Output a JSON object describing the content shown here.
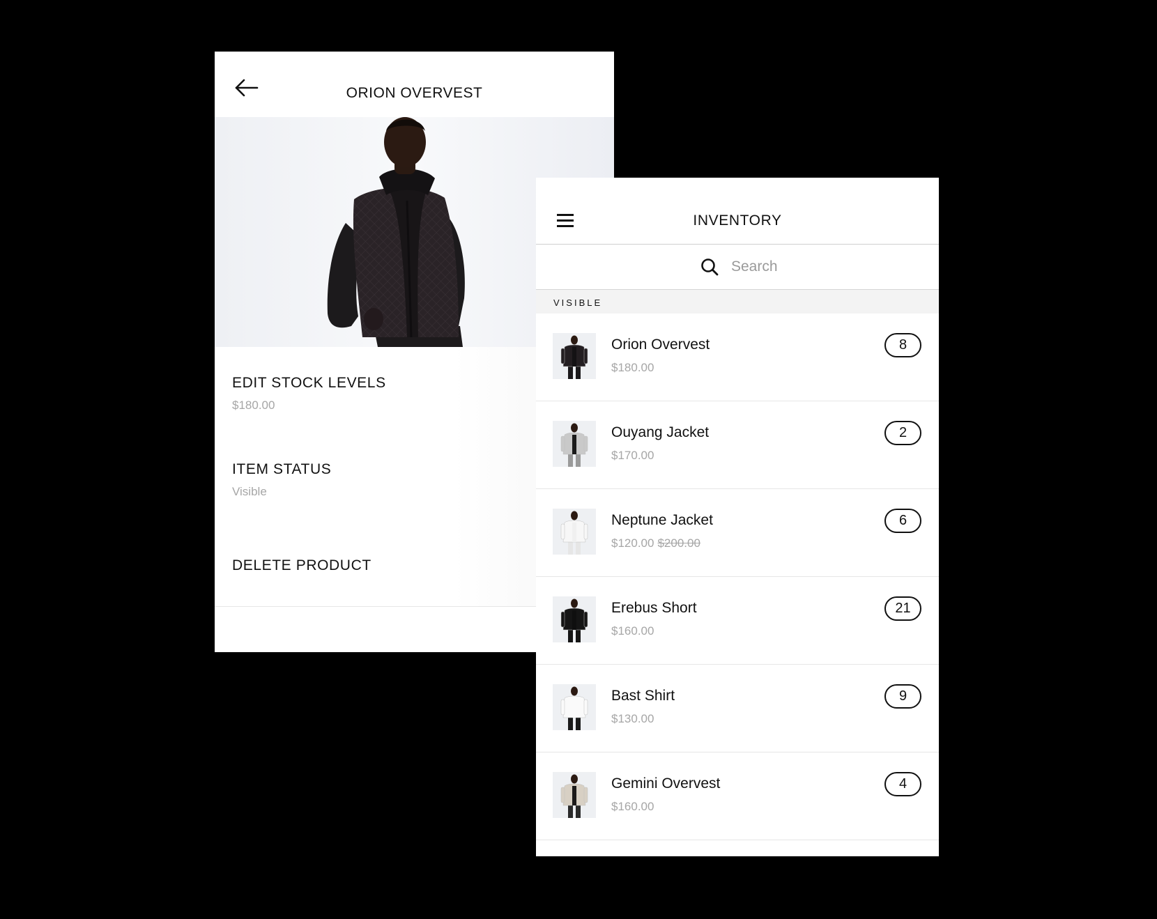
{
  "detail": {
    "title": "ORION OVERVEST",
    "sections": {
      "edit_stock": {
        "label": "EDIT STOCK LEVELS",
        "sub": "$180.00"
      },
      "item_status": {
        "label": "ITEM STATUS",
        "sub": "Visible"
      },
      "delete": {
        "label": "DELETE PRODUCT"
      }
    }
  },
  "inventory": {
    "title": "INVENTORY",
    "search": {
      "placeholder": "Search"
    },
    "section_label": "VISIBLE",
    "items": [
      {
        "name": "Orion Overvest",
        "price": "$180.00",
        "original_price": "",
        "qty": "8",
        "garment": "dark-vest"
      },
      {
        "name": "Ouyang Jacket",
        "price": "$170.00",
        "original_price": "",
        "qty": "2",
        "garment": "grey-jacket"
      },
      {
        "name": "Neptune Jacket",
        "price": "$120.00",
        "original_price": "$200.00",
        "qty": "6",
        "garment": "white-jacket"
      },
      {
        "name": "Erebus Short",
        "price": "$160.00",
        "original_price": "",
        "qty": "21",
        "garment": "black-outfit"
      },
      {
        "name": "Bast Shirt",
        "price": "$130.00",
        "original_price": "",
        "qty": "9",
        "garment": "white-tshirt"
      },
      {
        "name": "Gemini Overvest",
        "price": "$160.00",
        "original_price": "",
        "qty": "4",
        "garment": "beige-vest"
      }
    ]
  },
  "colors": {
    "background": "#000000",
    "panel": "#ffffff",
    "text": "#111111",
    "muted": "#a6a6a6",
    "section_bg": "#f3f3f3"
  },
  "icons": {
    "back": "arrow-left-icon",
    "menu": "hamburger-menu-icon",
    "search": "search-icon"
  }
}
